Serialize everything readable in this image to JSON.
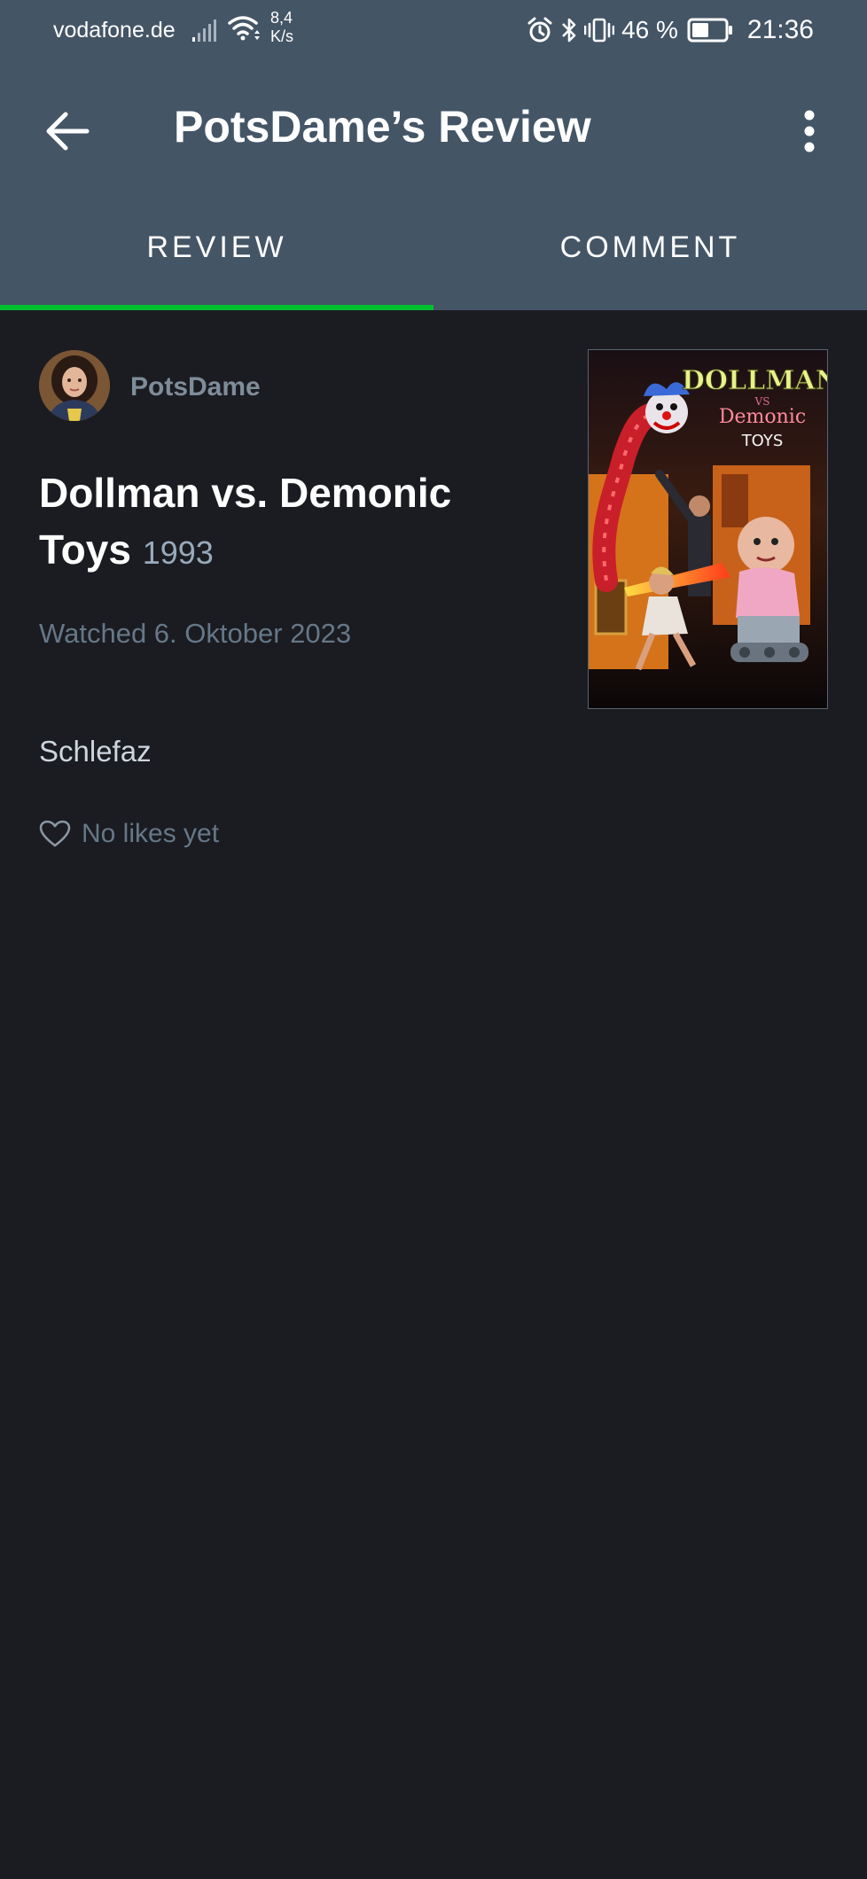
{
  "status_bar": {
    "carrier": "vodafone.de",
    "net_speed_value": "8,4",
    "net_speed_unit": "K/s",
    "battery_percent": "46 %",
    "time": "21:36",
    "icons": [
      "signal-icon",
      "wifi-icon",
      "alarm-icon",
      "bluetooth-icon",
      "vibrate-icon",
      "battery-icon"
    ]
  },
  "header": {
    "title": "PotsDame’s Review",
    "back_icon": "back-arrow-icon",
    "menu_icon": "more-vertical-icon"
  },
  "tabs": [
    {
      "label": "REVIEW",
      "active": true
    },
    {
      "label": "COMMENT",
      "active": false
    }
  ],
  "review": {
    "author": "PotsDame",
    "film_title": "Dollman vs. Demonic Toys",
    "film_year": "1993",
    "watched": "Watched 6. Oktober 2023",
    "text": "Schlefaz",
    "likes": "No likes yet"
  },
  "poster": {
    "line1": "DOLLMAN",
    "line2": "VS",
    "line3": "Demonic",
    "line4": "TOYS"
  },
  "colors": {
    "header_bg": "#445566",
    "page_bg": "#1a1c21",
    "tab_indicator": "#00c030",
    "muted_text": "#667788"
  }
}
